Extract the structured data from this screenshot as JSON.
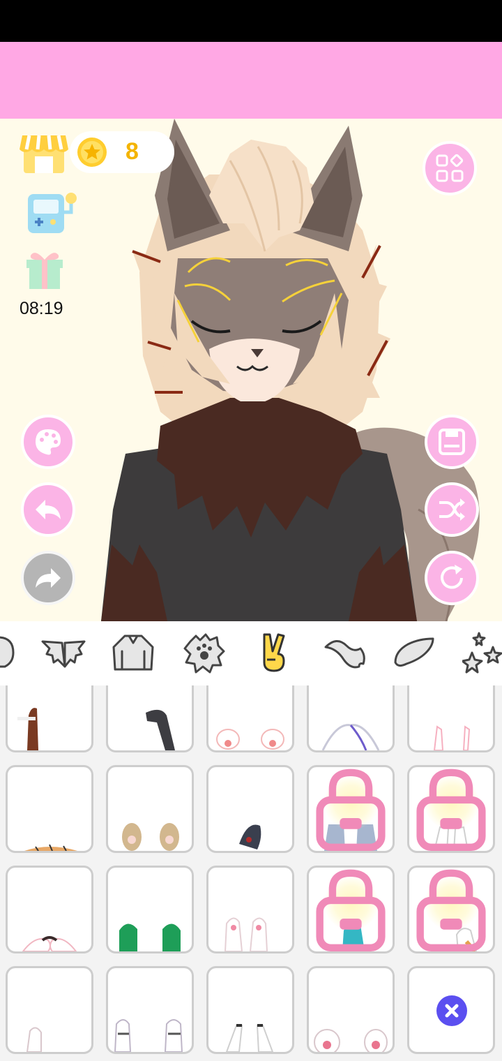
{
  "top_bar": {
    "coins": "8",
    "timer": "08:19"
  },
  "colors": {
    "accent_pink": "#fbb4e6",
    "ad_banner": "#ffa8e4",
    "canvas_bg": "#fffbea",
    "coin_gold": "#f4b400",
    "remove_button": "#5b4ff0"
  },
  "left_buttons": [
    "palette-icon",
    "undo-icon",
    "redo-icon"
  ],
  "right_buttons": [
    "grid-menu-icon",
    "save-icon",
    "shuffle-icon",
    "reset-icon"
  ],
  "category_tabs": [
    {
      "icon": "head-icon",
      "selected": false
    },
    {
      "icon": "wing-ears-icon",
      "selected": false
    },
    {
      "icon": "jacket-icon",
      "selected": false
    },
    {
      "icon": "paw-print-icon",
      "selected": false
    },
    {
      "icon": "hand-peace-icon",
      "selected": true
    },
    {
      "icon": "tail-icon",
      "selected": false
    },
    {
      "icon": "wing-icon",
      "selected": false
    },
    {
      "icon": "stars-icon",
      "selected": false
    }
  ],
  "item_grid": {
    "columns": 5,
    "rows": [
      [
        {
          "item": "hand-cigarette",
          "locked": false
        },
        {
          "item": "gray-paw-single",
          "locked": false
        },
        {
          "item": "pink-paws",
          "locked": false
        },
        {
          "item": "white-claws",
          "locked": false
        },
        {
          "item": "pink-hands",
          "locked": false
        }
      ],
      [
        {
          "item": "tiger-paws",
          "locked": false
        },
        {
          "item": "tan-paws",
          "locked": false
        },
        {
          "item": "dark-claw",
          "locked": false
        },
        {
          "item": "blue-claws",
          "locked": true
        },
        {
          "item": "bandaged-hands",
          "locked": true
        }
      ],
      [
        {
          "item": "heart-hands",
          "locked": false
        },
        {
          "item": "green-paws",
          "locked": false
        },
        {
          "item": "white-pink-paws",
          "locked": false
        },
        {
          "item": "teal-claw",
          "locked": true
        },
        {
          "item": "bandaged-fist",
          "locked": true
        }
      ],
      [
        {
          "item": "white-small-paws",
          "locked": false
        },
        {
          "item": "striped-paws",
          "locked": false
        },
        {
          "item": "white-long-claws",
          "locked": false
        },
        {
          "item": "white-beans-paws",
          "locked": false
        },
        {
          "item": "remove-item",
          "locked": false
        }
      ]
    ]
  }
}
